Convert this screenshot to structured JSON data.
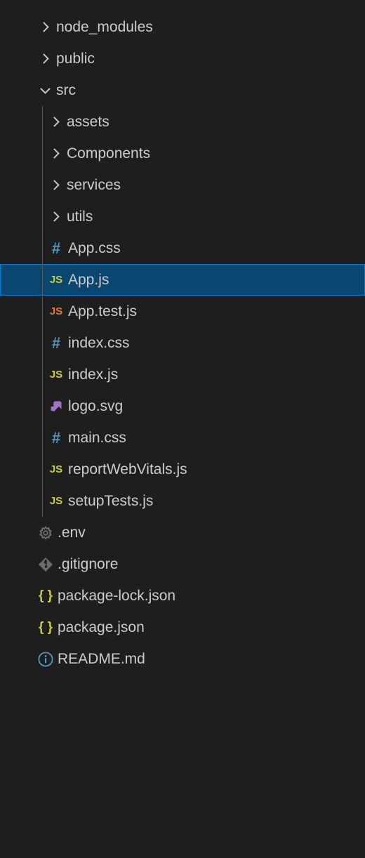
{
  "tree": {
    "items": [
      {
        "label": "node_modules",
        "type": "folder",
        "depth": 0,
        "expanded": false,
        "selected": false
      },
      {
        "label": "public",
        "type": "folder",
        "depth": 0,
        "expanded": false,
        "selected": false
      },
      {
        "label": "src",
        "type": "folder",
        "depth": 0,
        "expanded": true,
        "selected": false
      },
      {
        "label": "assets",
        "type": "folder",
        "depth": 1,
        "expanded": false,
        "selected": false,
        "guide": true
      },
      {
        "label": "Components",
        "type": "folder",
        "depth": 1,
        "expanded": false,
        "selected": false,
        "guide": true
      },
      {
        "label": "services",
        "type": "folder",
        "depth": 1,
        "expanded": false,
        "selected": false,
        "guide": true
      },
      {
        "label": "utils",
        "type": "folder",
        "depth": 1,
        "expanded": false,
        "selected": false,
        "guide": true
      },
      {
        "label": "App.css",
        "type": "file",
        "icon": "css",
        "depth": 1,
        "selected": false,
        "guide": true
      },
      {
        "label": "App.js",
        "type": "file",
        "icon": "js",
        "depth": 1,
        "selected": true,
        "guide": true
      },
      {
        "label": "App.test.js",
        "type": "file",
        "icon": "js-test",
        "depth": 1,
        "selected": false,
        "guide": true
      },
      {
        "label": "index.css",
        "type": "file",
        "icon": "css",
        "depth": 1,
        "selected": false,
        "guide": true
      },
      {
        "label": "index.js",
        "type": "file",
        "icon": "js",
        "depth": 1,
        "selected": false,
        "guide": true
      },
      {
        "label": "logo.svg",
        "type": "file",
        "icon": "svg",
        "depth": 1,
        "selected": false,
        "guide": true
      },
      {
        "label": "main.css",
        "type": "file",
        "icon": "css",
        "depth": 1,
        "selected": false,
        "guide": true
      },
      {
        "label": "reportWebVitals.js",
        "type": "file",
        "icon": "js",
        "depth": 1,
        "selected": false,
        "guide": true
      },
      {
        "label": "setupTests.js",
        "type": "file",
        "icon": "js",
        "depth": 1,
        "selected": false,
        "guide": true
      },
      {
        "label": ".env",
        "type": "file",
        "icon": "gear",
        "depth": 0,
        "selected": false
      },
      {
        "label": ".gitignore",
        "type": "file",
        "icon": "git",
        "depth": 0,
        "selected": false
      },
      {
        "label": "package-lock.json",
        "type": "file",
        "icon": "json",
        "depth": 0,
        "selected": false
      },
      {
        "label": "package.json",
        "type": "file",
        "icon": "json",
        "depth": 0,
        "selected": false
      },
      {
        "label": "README.md",
        "type": "file",
        "icon": "info",
        "depth": 0,
        "selected": false
      }
    ]
  },
  "icons": {
    "js": "JS",
    "js-test": "JS",
    "css": "#",
    "json": "{ }"
  }
}
